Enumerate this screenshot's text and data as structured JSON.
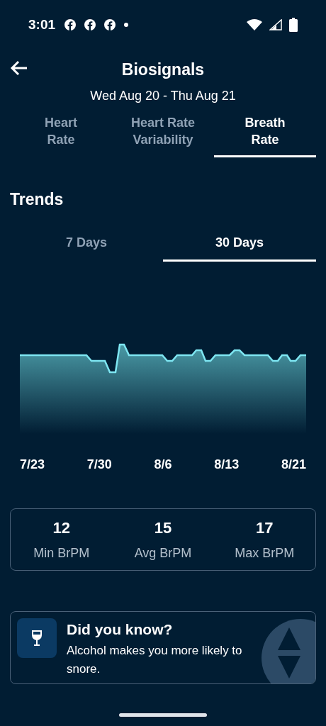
{
  "status_bar": {
    "time": "3:01",
    "notifications": [
      {
        "kind": "facebook"
      },
      {
        "kind": "facebook"
      },
      {
        "kind": "facebook"
      }
    ]
  },
  "header": {
    "title": "Biosignals",
    "date_range": "Wed Aug 20 - Thu Aug 21"
  },
  "tabs": [
    {
      "label": "Heart\nRate",
      "selected": false
    },
    {
      "label": "Heart Rate\nVariability",
      "selected": false
    },
    {
      "label": "Breath\nRate",
      "selected": true
    }
  ],
  "trends": {
    "title": "Trends",
    "periods": [
      {
        "label": "7 Days",
        "selected": false
      },
      {
        "label": "30 Days",
        "selected": true
      }
    ],
    "x_labels": [
      "7/23",
      "7/30",
      "8/6",
      "8/13",
      "8/21"
    ]
  },
  "stats": [
    {
      "value": "12",
      "label": "Min BrPM"
    },
    {
      "value": "15",
      "label": "Avg BrPM"
    },
    {
      "value": "17",
      "label": "Max BrPM"
    }
  ],
  "tip": {
    "title": "Did you know?",
    "text": "Alcohol makes you more likely to snore."
  }
}
